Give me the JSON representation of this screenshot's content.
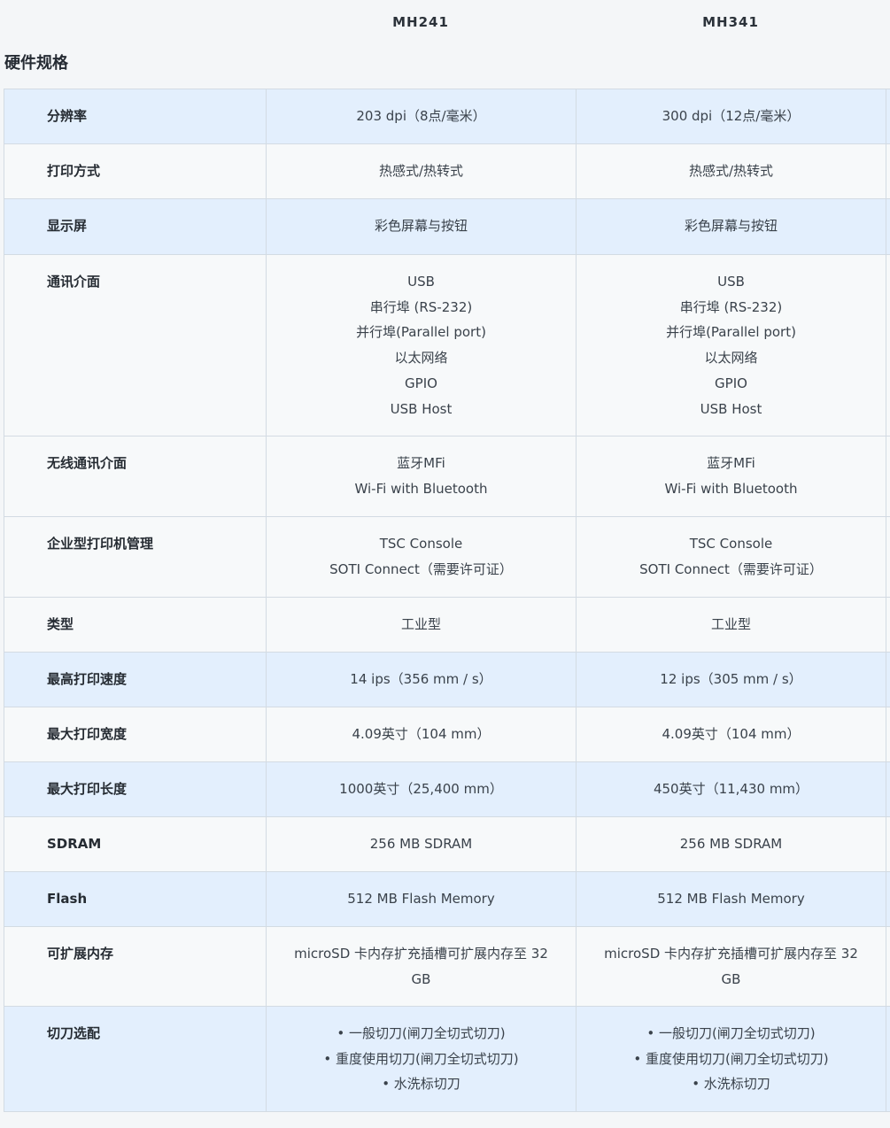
{
  "header": {
    "models": [
      "MH241",
      "MH341"
    ]
  },
  "section_title": "硬件规格",
  "rows": [
    {
      "label": "分辨率",
      "mh241": [
        "203 dpi（8点/毫米）"
      ],
      "mh341": [
        "300 dpi（12点/毫米）"
      ]
    },
    {
      "label": "打印方式",
      "mh241": [
        "热感式/热转式"
      ],
      "mh341": [
        "热感式/热转式"
      ]
    },
    {
      "label": "显示屏",
      "mh241": [
        "彩色屏幕与按钮"
      ],
      "mh341": [
        "彩色屏幕与按钮"
      ]
    },
    {
      "label": "通讯介面",
      "mh241": [
        "USB",
        "串行埠 (RS-232)",
        "并行埠(Parallel port)",
        "以太网络",
        "GPIO",
        "USB Host"
      ],
      "mh341": [
        "USB",
        "串行埠 (RS-232)",
        "并行埠(Parallel port)",
        "以太网络",
        "GPIO",
        "USB Host"
      ]
    },
    {
      "label": "无线通讯介面",
      "mh241": [
        "蓝牙MFi",
        "Wi-Fi with Bluetooth"
      ],
      "mh341": [
        "蓝牙MFi",
        "Wi-Fi with Bluetooth"
      ]
    },
    {
      "label": "企业型打印机管理",
      "mh241": [
        "TSC Console",
        "SOTI Connect（需要许可证）"
      ],
      "mh341": [
        "TSC Console",
        "SOTI Connect（需要许可证）"
      ]
    },
    {
      "label": "类型",
      "mh241": [
        "工业型"
      ],
      "mh341": [
        "工业型"
      ]
    },
    {
      "label": "最高打印速度",
      "mh241": [
        "14 ips（356 mm / s）"
      ],
      "mh341": [
        "12 ips（305 mm / s）"
      ]
    },
    {
      "label": "最大打印宽度",
      "mh241": [
        "4.09英寸（104 mm）"
      ],
      "mh341": [
        "4.09英寸（104 mm）"
      ]
    },
    {
      "label": "最大打印长度",
      "mh241": [
        "1000英寸（25,400 mm）"
      ],
      "mh341": [
        "450英寸（11,430 mm）"
      ]
    },
    {
      "label": "SDRAM",
      "mh241": [
        "256 MB SDRAM"
      ],
      "mh341": [
        "256 MB SDRAM"
      ]
    },
    {
      "label": "Flash",
      "mh241": [
        "512 MB Flash Memory"
      ],
      "mh341": [
        "512 MB Flash Memory"
      ]
    },
    {
      "label": "可扩展内存",
      "mh241": [
        "microSD 卡内存扩充插槽可扩展内存至 32",
        "GB"
      ],
      "mh341": [
        "microSD 卡内存扩充插槽可扩展内存至 32",
        "GB"
      ]
    },
    {
      "label": "切刀选配",
      "mh241": [
        "• 一般切刀(闸刀全切式切刀)",
        "• 重度使用切刀(闸刀全切式切刀)",
        "• 水洗标切刀"
      ],
      "mh341": [
        "• 一般切刀(闸刀全切式切刀)",
        "• 重度使用切刀(闸刀全切式切刀)",
        "• 水洗标切刀"
      ]
    }
  ],
  "colors": {
    "row_blue": "#e3effd",
    "row_white": "#f7f9fa",
    "border": "#d3dbe3"
  }
}
